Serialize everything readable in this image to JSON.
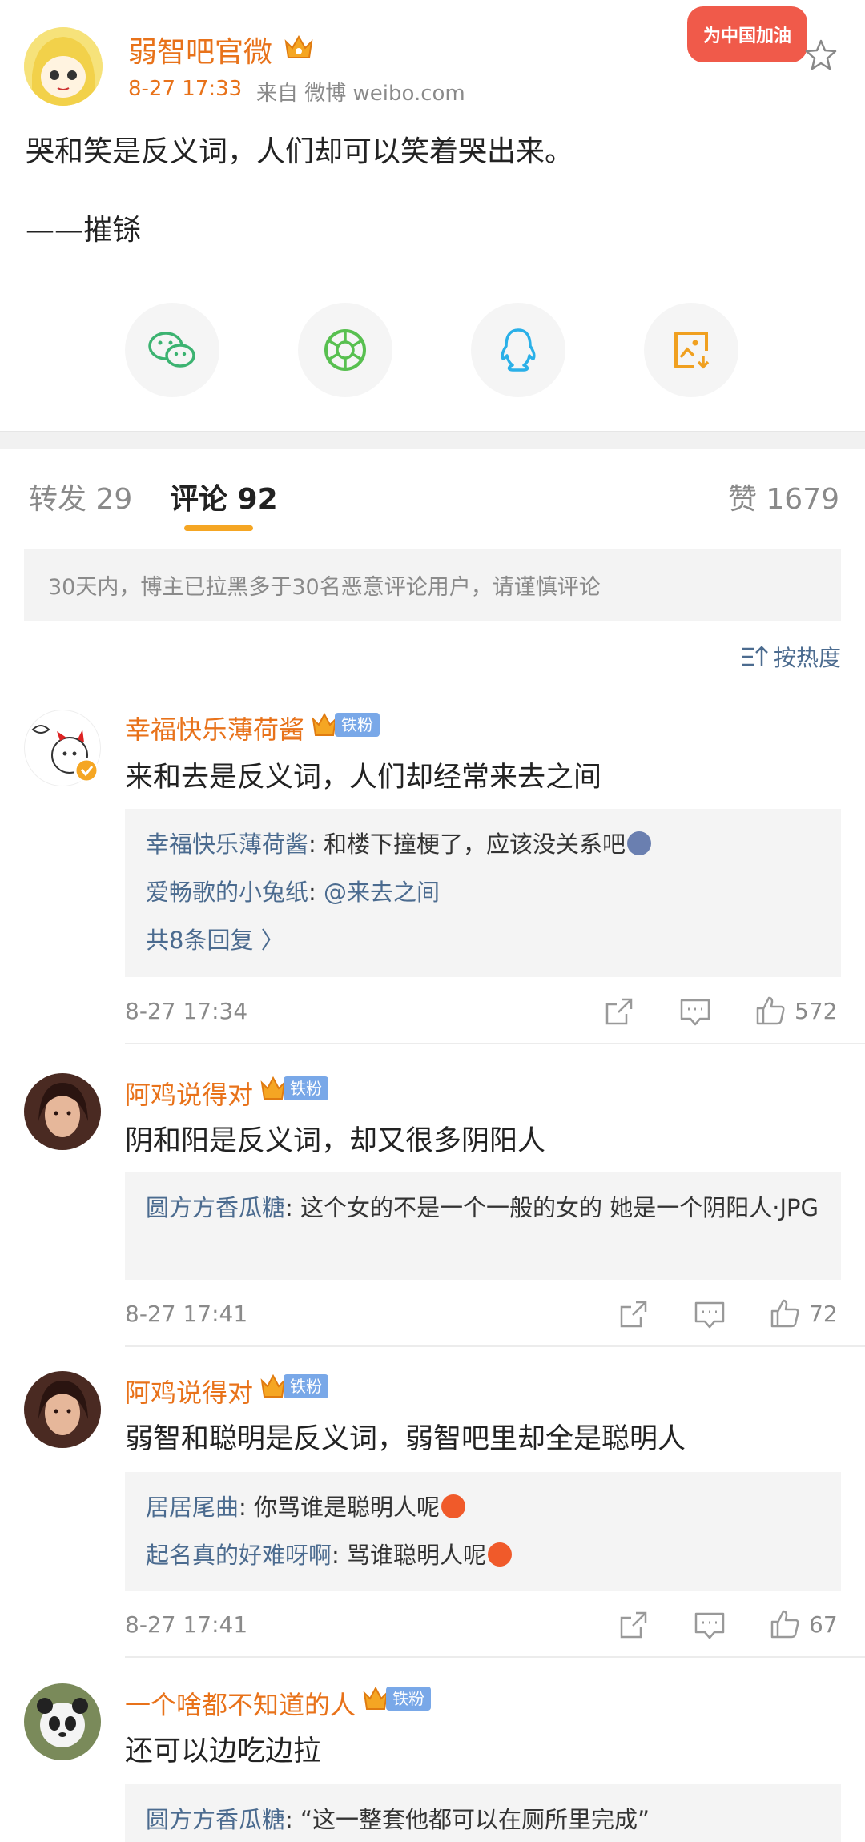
{
  "post": {
    "author": "弱智吧官微",
    "time": "8-27 17:33",
    "source": "来自 微博 weibo.com",
    "text": "哭和笑是反义词，人们却可以笑着哭出来。",
    "signature": "——摧铩",
    "promo_badge": "为中国加油"
  },
  "share_icons": [
    "wechat-icon",
    "moments-icon",
    "qq-icon",
    "save-image-icon"
  ],
  "tabs": {
    "repost": "转发 29",
    "comment": "评论 92",
    "like": "赞 1679"
  },
  "notice": "30天内，博主已拉黑多于30名恶意评论用户，请谨慎评论",
  "sort_label": "按热度",
  "fan_badge": "铁粉",
  "comments": [
    {
      "user": "幸福快乐薄荷酱",
      "text": "来和去是反义词，人们却经常来去之间",
      "replies": [
        {
          "user": "幸福快乐薄荷酱",
          "sep": ": ",
          "text": "和楼下撞梗了，应该没关系吧"
        },
        {
          "user": "爱畅歌的小兔纸",
          "sep": ": ",
          "text": "@来去之间"
        }
      ],
      "more": "共8条回复 〉",
      "time": "8-27 17:34",
      "likes": "572"
    },
    {
      "user": "阿鸡说得对",
      "text": "阴和阳是反义词，却又很多阴阳人",
      "replies": [
        {
          "user": "圆方方香瓜糖",
          "sep": ": ",
          "text": "这个女的不是一个一般的女的 她是一个阴阳人·JPG"
        }
      ],
      "time": "8-27 17:41",
      "likes": "72"
    },
    {
      "user": "阿鸡说得对",
      "text": "弱智和聪明是反义词，弱智吧里却全是聪明人",
      "replies": [
        {
          "user": "居居尾曲",
          "sep": ": ",
          "text": "你骂谁是聪明人呢"
        },
        {
          "user": "起名真的好难呀啊",
          "sep": ": ",
          "text": "骂谁聪明人呢"
        }
      ],
      "time": "8-27 17:41",
      "likes": "67"
    },
    {
      "user": "一个啥都不知道的人",
      "text": "还可以边吃边拉",
      "replies": [
        {
          "user": "圆方方香瓜糖",
          "sep": ": ",
          "text": "“这一整套他都可以在厕所里完成”"
        }
      ]
    }
  ],
  "colors": {
    "username": "#e8721a",
    "link": "#4b6b8f",
    "accent": "#f5a623",
    "fan_badge": "#79a8e8"
  }
}
